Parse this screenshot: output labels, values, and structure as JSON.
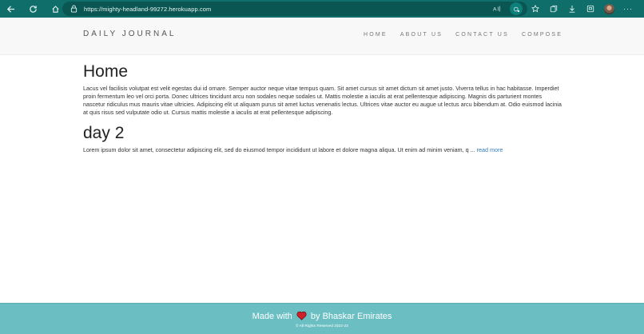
{
  "browser": {
    "url": "https://mighty-headland-99272.herokuapp.com",
    "address_icons": [
      "read-aloud-icon",
      "tracking-icon"
    ],
    "toolbar_icons": [
      "favorites-icon",
      "collections-icon",
      "downloads-icon",
      "screenshot-icon"
    ]
  },
  "navbar": {
    "brand": "DAILY JOURNAL",
    "links": [
      "HOME",
      "ABOUT US",
      "CONTACT US",
      "COMPOSE"
    ]
  },
  "page": {
    "title": "Home",
    "intro": "Lacus vel facilisis volutpat est velit egestas dui id ornare. Semper auctor neque vitae tempus quam. Sit amet cursus sit amet dictum sit amet justo. Viverra tellus in hac habitasse. Imperdiet proin fermentum leo vel orci porta. Donec ultrices tincidunt arcu non sodales neque sodales ut. Mattis molestie a iaculis at erat pellentesque adipiscing. Magnis dis parturient montes nascetur ridiculus mus mauris vitae ultricies. Adipiscing elit ut aliquam purus sit amet luctus venenatis lectus. Ultrices vitae auctor eu augue ut lectus arcu bibendum at. Odio euismod lacinia at quis risus sed vulputate odio ut. Cursus mattis molestie a iaculis at erat pellentesque adipiscing."
  },
  "posts": [
    {
      "title": "day 2",
      "excerpt": "Lorem ipsum dolor sit amet, consectetur adipiscing elit, sed do eiusmod tempor incididunt ut labore et dolore magna aliqua. Ut enim ad minim veniam, q ... ",
      "read_more": "read more"
    }
  ],
  "footer": {
    "made_with_prefix": "Made with",
    "made_with_suffix": "by Bhaskar Emirates",
    "copyright": "© All Rights Reserved 2022-23",
    "heart_color": "#d0202a",
    "background": "#6bbfc2"
  }
}
